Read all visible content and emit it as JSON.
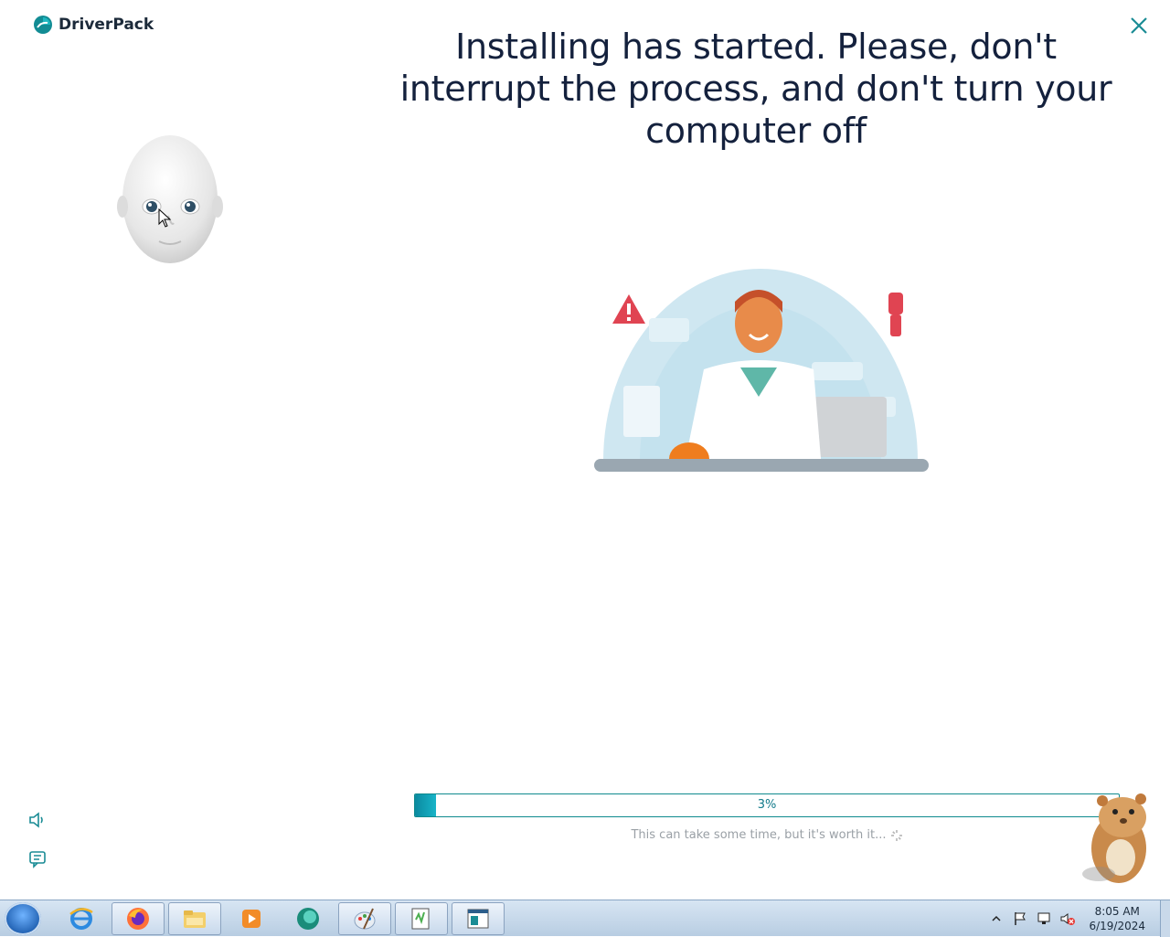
{
  "app": {
    "logo_text": "DriverPack",
    "title": "Installing has started. Please, don't interrupt the process, and don't turn your computer off",
    "progress": {
      "percent": 3,
      "label": "3%"
    },
    "hint": "This can take some time, but it's worth it..."
  },
  "icons": {
    "close": "close-icon",
    "sound": "speaker-icon",
    "chat": "chat-icon"
  },
  "taskbar": {
    "apps": [
      "internet-explorer",
      "firefox",
      "file-explorer",
      "media-player",
      "driverpack",
      "paint",
      "notepad-editor",
      "app-window"
    ],
    "clock": {
      "time": "8:05 AM",
      "date": "6/19/2024"
    }
  },
  "colors": {
    "accent": "#0f8a8e",
    "title": "#14213d"
  }
}
